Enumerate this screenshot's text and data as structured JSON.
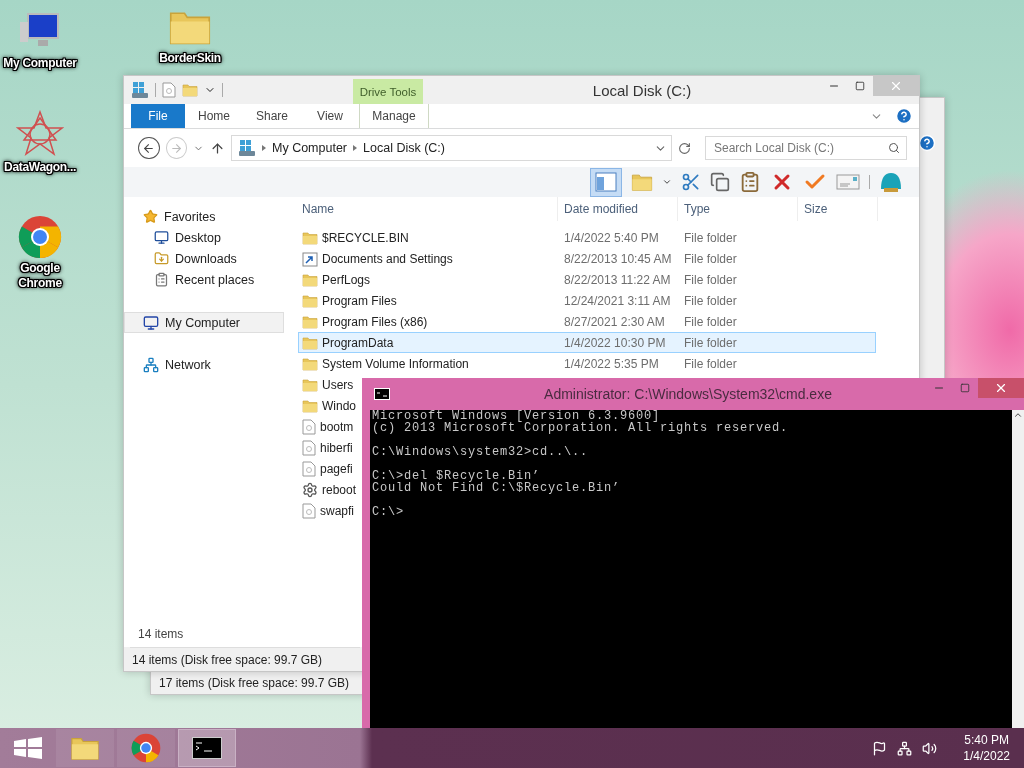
{
  "desktop_icons": [
    {
      "label": "My Computer",
      "kind": "computer"
    },
    {
      "label": "BorderSkin",
      "kind": "folder"
    },
    {
      "label": "DataWagon...",
      "kind": "star"
    },
    {
      "label": "Google Chrome",
      "kind": "chrome"
    }
  ],
  "back_window": {
    "status": "17 items (Disk free space: 99.7 GB)"
  },
  "explorer": {
    "title": "Local Disk (C:)",
    "context_group": "Drive Tools",
    "tabs": [
      {
        "label": "File",
        "kind": "file"
      },
      {
        "label": "Home",
        "kind": "plain"
      },
      {
        "label": "Share",
        "kind": "plain"
      },
      {
        "label": "View",
        "kind": "plain"
      },
      {
        "label": "Manage",
        "kind": "context"
      }
    ],
    "address": [
      "My Computer",
      "Local Disk (C:)"
    ],
    "search": {
      "placeholder": "Search Local Disk (C:)"
    },
    "nav": [
      {
        "label": "Favorites",
        "kind": "star",
        "selected": false,
        "children": [
          {
            "label": "Desktop",
            "kind": "desktop",
            "selected": false
          },
          {
            "label": "Downloads",
            "kind": "downloads",
            "selected": false
          },
          {
            "label": "Recent places",
            "kind": "recent",
            "selected": false
          }
        ]
      },
      {
        "label": "My Computer",
        "kind": "computer",
        "selected": true
      },
      {
        "label": "Network",
        "kind": "network",
        "selected": false
      }
    ],
    "columns": [
      "Name",
      "Date modified",
      "Type",
      "Size"
    ],
    "rows": [
      {
        "name": "$RECYCLE.BIN",
        "date": "1/4/2022 5:40 PM",
        "type": "File folder",
        "kind": "folder",
        "selected": false
      },
      {
        "name": "Documents and Settings",
        "date": "8/22/2013 10:45 AM",
        "type": "File folder",
        "kind": "shortcut",
        "selected": false
      },
      {
        "name": "PerfLogs",
        "date": "8/22/2013 11:22 AM",
        "type": "File folder",
        "kind": "folder",
        "selected": false
      },
      {
        "name": "Program Files",
        "date": "12/24/2021 3:11 AM",
        "type": "File folder",
        "kind": "folder",
        "selected": false
      },
      {
        "name": "Program Files (x86)",
        "date": "8/27/2021 2:30 AM",
        "type": "File folder",
        "kind": "folder",
        "selected": false
      },
      {
        "name": "ProgramData",
        "date": "1/4/2022 10:30 PM",
        "type": "File folder",
        "kind": "folder",
        "selected": true
      },
      {
        "name": "System Volume Information",
        "date": "1/4/2022 5:35 PM",
        "type": "File folder",
        "kind": "folder",
        "selected": false
      },
      {
        "name": "Users",
        "kind": "folder",
        "selected": false
      },
      {
        "name": "Windo",
        "kind": "folder",
        "selected": false
      },
      {
        "name": "bootm",
        "kind": "file",
        "selected": false
      },
      {
        "name": "hiberfi",
        "kind": "file",
        "selected": false
      },
      {
        "name": "pagefi",
        "kind": "file",
        "selected": false
      },
      {
        "name": "reboot",
        "kind": "gear",
        "selected": false
      },
      {
        "name": "swapfi",
        "kind": "file",
        "selected": false
      }
    ],
    "item_count": "14 items",
    "status": "14 items (Disk free space: 99.7 GB)"
  },
  "cmd": {
    "title": "Administrator: C:\\Windows\\System32\\cmd.exe",
    "blocks": [
      [
        "Microsoft Windows [Version 6.3.9600]",
        "(c) 2013 Microsoft Corporation. All rights reserved."
      ],
      [
        "C:\\Windows\\system32>cd..\\.."
      ],
      [
        "C:\\>del $Recycle.Bin’",
        "Could Not Find C:\\$Recycle.Bin’"
      ],
      [
        "C:\\>"
      ]
    ]
  },
  "taskbar": {
    "apps": [
      {
        "kind": "explorer",
        "selected": false
      },
      {
        "kind": "chrome",
        "selected": false
      },
      {
        "kind": "cmd",
        "selected": true
      }
    ],
    "time": "5:40 PM",
    "date": "1/4/2022"
  }
}
